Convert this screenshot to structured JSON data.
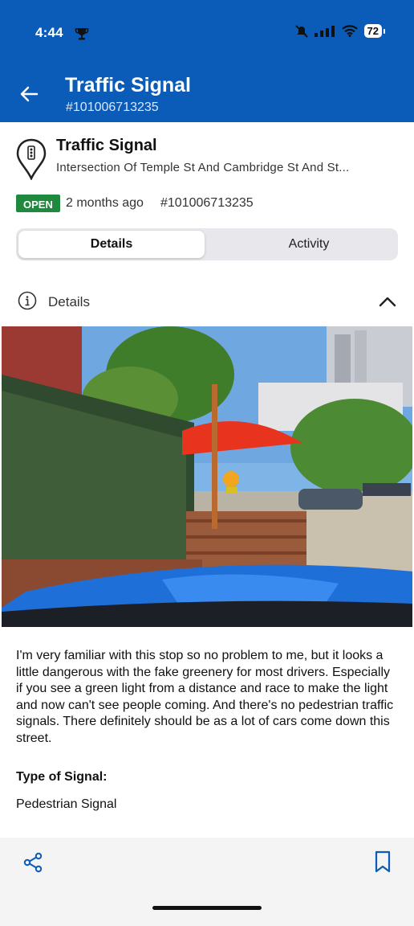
{
  "status_bar": {
    "time": "4:44",
    "battery": "72",
    "icons": [
      "trophy-icon",
      "mute-icon",
      "signal-icon",
      "wifi-icon",
      "battery-icon"
    ]
  },
  "header": {
    "title": "Traffic Signal",
    "subtitle": "#101006713235",
    "back_icon": "arrow-left-icon",
    "background": "#0b5cb8"
  },
  "request": {
    "title": "Traffic Signal",
    "address": "Intersection Of Temple St And Cambridge St And St...",
    "status": "OPEN",
    "status_color": "#1f8a3d",
    "age": "2 months ago",
    "id": "#101006713235",
    "icon": "traffic-light-pin-icon"
  },
  "tabs": [
    {
      "label": "Details",
      "active": true
    },
    {
      "label": "Activity",
      "active": false
    }
  ],
  "details_section": {
    "label": "Details",
    "icon": "info-icon",
    "toggle_icon": "chevron-up-icon"
  },
  "description": "I'm very familiar with this stop so no problem to me, but it looks a little dangerous with the fake greenery for most drivers. Especially if you see a green light from a distance and race to make the light and now can't see people coming. And there's no pedestrian traffic signals. There definitely should be as a lot of cars come down this street.",
  "fields": [
    {
      "label": "Type of Signal:",
      "value": "Pedestrian Signal"
    }
  ],
  "bottom_bar": {
    "share_icon": "share-icon",
    "bookmark_icon": "bookmark-icon"
  }
}
